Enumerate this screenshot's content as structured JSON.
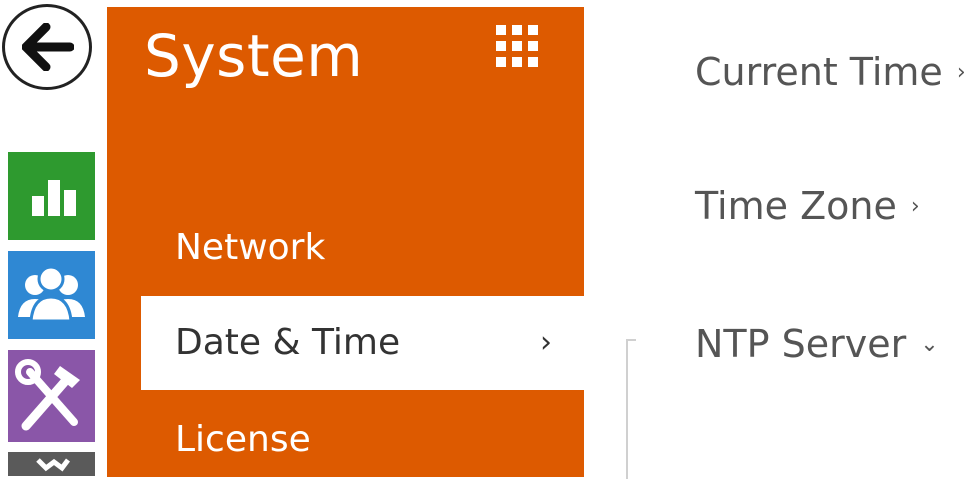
{
  "nav_rail": {
    "back_icon": "arrow-left-icon",
    "items": [
      {
        "icon": "bar-chart-icon",
        "color": "#2e9a2f"
      },
      {
        "icon": "users-icon",
        "color": "#2f88d3"
      },
      {
        "icon": "tools-icon",
        "color": "#8a56a8"
      },
      {
        "icon": "puzzle-icon",
        "color": "#5a5a5a"
      }
    ]
  },
  "panel": {
    "title": "System",
    "grid_icon": "grid-icon",
    "color": "#dd5a00",
    "menu": [
      {
        "label": "Network"
      },
      {
        "label": "Date & Time",
        "active": true,
        "chevron": "›"
      },
      {
        "label": "License"
      }
    ]
  },
  "content": {
    "sections": [
      {
        "label": "Current Time",
        "chevron": "›"
      },
      {
        "label": "Time Zone",
        "chevron": "›"
      },
      {
        "label": "NTP Server",
        "chevron": "⌄"
      }
    ]
  }
}
